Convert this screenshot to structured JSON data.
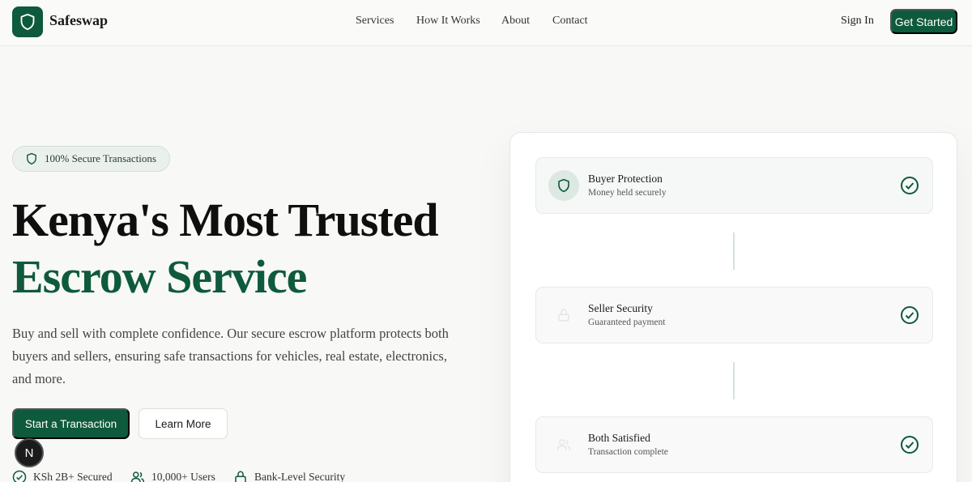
{
  "nav": {
    "brand": "Safeswap",
    "links": [
      "Services",
      "How It Works",
      "About",
      "Contact"
    ],
    "sign_in": "Sign In",
    "get_started": "Get Started"
  },
  "hero": {
    "badge": "100% Secure Transactions",
    "title_line1": "Kenya's Most Trusted",
    "title_line2": "Escrow Service",
    "description": "Buy and sell with complete confidence. Our secure escrow platform protects both buyers and sellers, ensuring safe transactions for vehicles, real estate, electronics, and more.",
    "primary_button": "Start a Transaction",
    "secondary_button": "Learn More",
    "dev_badge": "N",
    "stats": [
      "KSh 2B+ Secured",
      "10,000+ Users",
      "Bank-Level Security"
    ]
  },
  "process_card": {
    "steps": [
      {
        "title": "Buyer Protection",
        "subtitle": "Money held securely",
        "icon": "shield-icon"
      },
      {
        "title": "Seller Security",
        "subtitle": "Guaranteed payment",
        "icon": "lock-icon"
      },
      {
        "title": "Both Satisfied",
        "subtitle": "Transaction complete",
        "icon": "users-icon"
      }
    ]
  },
  "colors": {
    "brand_green": "#0e5a3c",
    "background": "#f8f8f6"
  }
}
